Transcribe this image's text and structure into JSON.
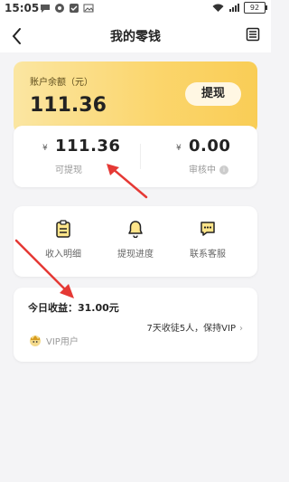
{
  "status_bar": {
    "time": "15:05",
    "battery": "92"
  },
  "header": {
    "title": "我的零钱"
  },
  "balance_banner": {
    "label": "账户余额（元）",
    "value": "111.36",
    "withdraw_button": "提现"
  },
  "balances": {
    "currency_symbol": "¥",
    "available_amount": "111.36",
    "available_label": "可提现",
    "pending_amount": "0.00",
    "pending_label": "审核中"
  },
  "menu": {
    "items": [
      {
        "label": "收入明细",
        "icon": "clipboard-icon"
      },
      {
        "label": "提现进度",
        "icon": "bell-icon"
      },
      {
        "label": "联系客服",
        "icon": "chat-icon"
      }
    ]
  },
  "earnings": {
    "today": "今日收益：31.00元",
    "promo": "7天收徒5人，保持VIP",
    "vip_label": "VIP用户"
  },
  "colors": {
    "accent": "#f9cd56",
    "annotation_arrow": "#e53935"
  }
}
